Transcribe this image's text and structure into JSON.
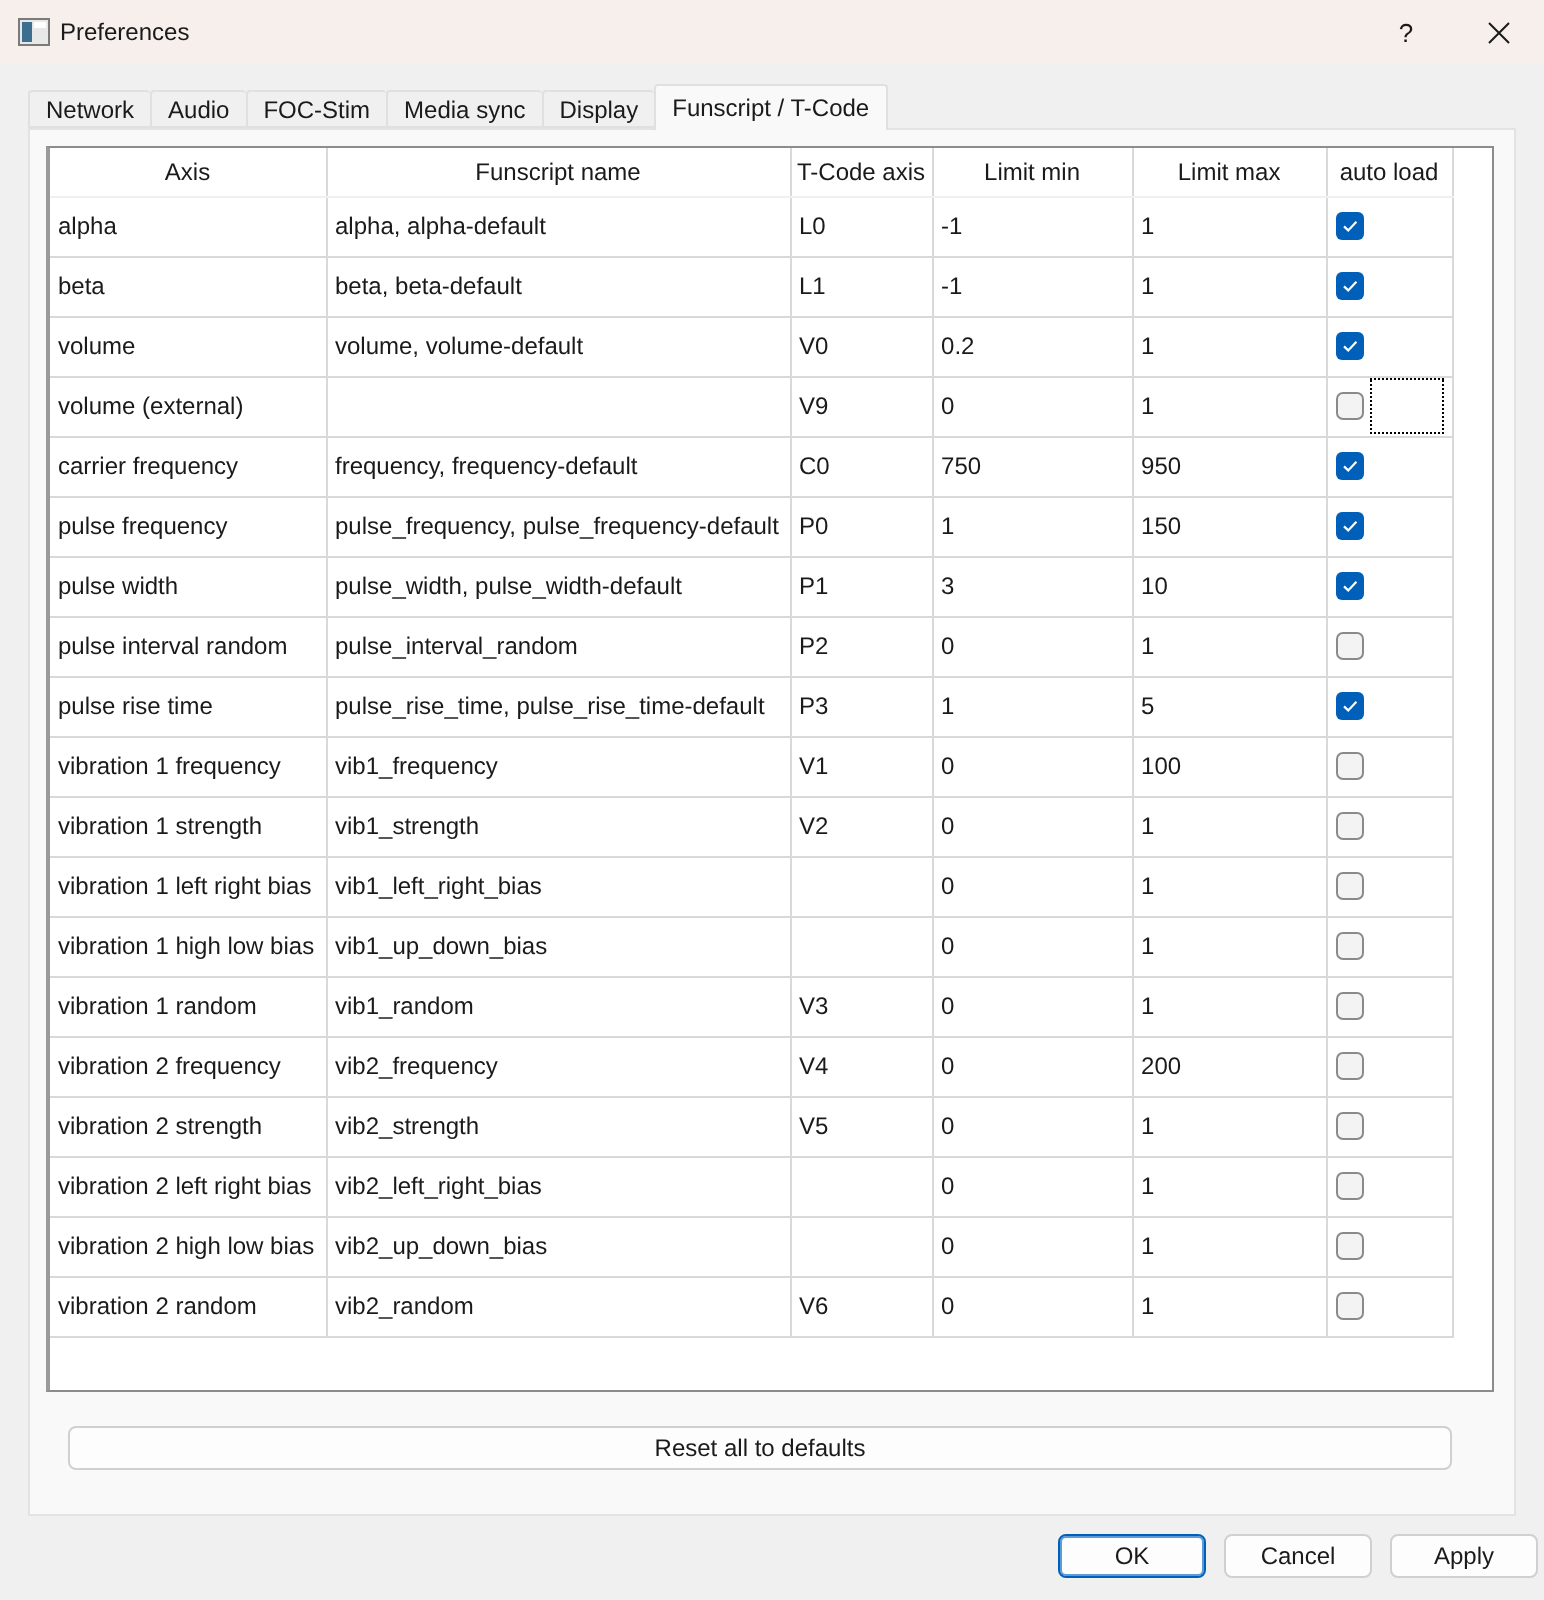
{
  "window": {
    "title": "Preferences",
    "help_button": "?"
  },
  "tabs": [
    {
      "label": "Network",
      "selected": false
    },
    {
      "label": "Audio",
      "selected": false
    },
    {
      "label": "FOC-Stim",
      "selected": false
    },
    {
      "label": "Media sync",
      "selected": false
    },
    {
      "label": "Display",
      "selected": false
    },
    {
      "label": "Funscript / T-Code",
      "selected": true
    }
  ],
  "table": {
    "columns": [
      "Axis",
      "Funscript name",
      "T-Code axis",
      "Limit min",
      "Limit max",
      "auto load"
    ],
    "rows": [
      {
        "axis": "alpha",
        "funscript": "alpha, alpha-default",
        "tcode": "L0",
        "min": "-1",
        "max": "1",
        "auto_load": true,
        "focused": false
      },
      {
        "axis": "beta",
        "funscript": "beta, beta-default",
        "tcode": "L1",
        "min": "-1",
        "max": "1",
        "auto_load": true,
        "focused": false
      },
      {
        "axis": "volume",
        "funscript": "volume, volume-default",
        "tcode": "V0",
        "min": "0.2",
        "max": "1",
        "auto_load": true,
        "focused": false
      },
      {
        "axis": "volume (external)",
        "tcode": "V9",
        "min": "0",
        "max": "1",
        "auto_load": false,
        "focused": true
      },
      {
        "axis": "carrier frequency",
        "funscript": "frequency, frequency-default",
        "tcode": "C0",
        "min": "750",
        "max": "950",
        "auto_load": true,
        "focused": false
      },
      {
        "axis": "pulse frequency",
        "funscript": "pulse_frequency, pulse_frequency-default",
        "tcode": "P0",
        "min": "1",
        "max": "150",
        "auto_load": true,
        "focused": false
      },
      {
        "axis": "pulse width",
        "funscript": "pulse_width, pulse_width-default",
        "tcode": "P1",
        "min": "3",
        "max": "10",
        "auto_load": true,
        "focused": false
      },
      {
        "axis": "pulse interval random",
        "funscript": "pulse_interval_random",
        "tcode": "P2",
        "min": "0",
        "max": "1",
        "auto_load": false,
        "focused": false
      },
      {
        "axis": "pulse rise time",
        "funscript": "pulse_rise_time, pulse_rise_time-default",
        "tcode": "P3",
        "min": "1",
        "max": "5",
        "auto_load": true,
        "focused": false
      },
      {
        "axis": "vibration 1 frequency",
        "funscript": "vib1_frequency",
        "tcode": "V1",
        "min": "0",
        "max": "100",
        "auto_load": false,
        "focused": false
      },
      {
        "axis": "vibration 1 strength",
        "funscript": "vib1_strength",
        "tcode": "V2",
        "min": "0",
        "max": "1",
        "auto_load": false,
        "focused": false
      },
      {
        "axis": "vibration 1 left right bias",
        "funscript": "vib1_left_right_bias",
        "min": "0",
        "max": "1",
        "auto_load": false,
        "focused": false
      },
      {
        "axis": "vibration 1 high low bias",
        "funscript": "vib1_up_down_bias",
        "min": "0",
        "max": "1",
        "auto_load": false,
        "focused": false
      },
      {
        "axis": "vibration 1 random",
        "funscript": "vib1_random",
        "tcode": "V3",
        "min": "0",
        "max": "1",
        "auto_load": false,
        "focused": false
      },
      {
        "axis": "vibration 2 frequency",
        "funscript": "vib2_frequency",
        "tcode": "V4",
        "min": "0",
        "max": "200",
        "auto_load": false,
        "focused": false
      },
      {
        "axis": "vibration 2 strength",
        "funscript": "vib2_strength",
        "tcode": "V5",
        "min": "0",
        "max": "1",
        "auto_load": false,
        "focused": false
      },
      {
        "axis": "vibration 2 left right bias",
        "funscript": "vib2_left_right_bias",
        "min": "0",
        "max": "1",
        "auto_load": false,
        "focused": false
      },
      {
        "axis": "vibration 2 high low bias",
        "funscript": "vib2_up_down_bias",
        "min": "0",
        "max": "1",
        "auto_load": false,
        "focused": false
      },
      {
        "axis": "vibration 2 random",
        "funscript": "vib2_random",
        "tcode": "V6",
        "min": "0",
        "max": "1",
        "auto_load": false,
        "focused": false
      }
    ]
  },
  "reset_button": "Reset all to defaults",
  "buttons": [
    {
      "label": "OK",
      "default": true
    },
    {
      "label": "Cancel",
      "default": false
    },
    {
      "label": "Apply",
      "default": false
    }
  ]
}
